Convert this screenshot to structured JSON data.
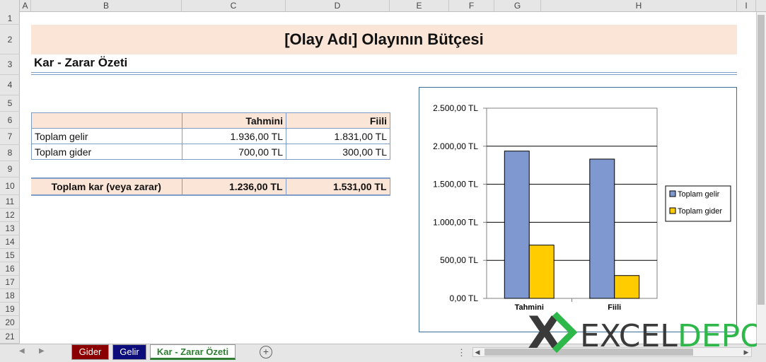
{
  "columns": [
    "A",
    "B",
    "C",
    "D",
    "E",
    "F",
    "G",
    "H",
    "I"
  ],
  "rows": [
    "1",
    "2",
    "3",
    "4",
    "5",
    "6",
    "7",
    "8",
    "9",
    "10",
    "11",
    "12",
    "13",
    "14",
    "15",
    "16",
    "17",
    "18",
    "19",
    "20",
    "21"
  ],
  "sheet": {
    "title": "[Olay Adı] Olayının Bütçesi",
    "subtitle": "Kar - Zarar Özeti",
    "table": {
      "headers": [
        "",
        "Tahmini",
        "Fiili"
      ],
      "rows": [
        {
          "label": "Toplam gelir",
          "tahmini": "1.936,00 TL",
          "fiili": "1.831,00 TL"
        },
        {
          "label": "Toplam gider",
          "tahmini": "700,00 TL",
          "fiili": "300,00 TL"
        }
      ],
      "total": {
        "label": "Toplam kar (veya zarar)",
        "tahmini": "1.236,00 TL",
        "fiili": "1.531,00 TL"
      }
    }
  },
  "chart_data": {
    "type": "bar",
    "categories": [
      "Tahmini",
      "Fiili"
    ],
    "series": [
      {
        "name": "Toplam gelir",
        "values": [
          1936,
          1831
        ],
        "color": "#7f98cf"
      },
      {
        "name": "Toplam gider",
        "values": [
          700,
          300
        ],
        "color": "#ffcc00"
      }
    ],
    "ylim": [
      0,
      2500
    ],
    "yticks": [
      "0,00 TL",
      "500,00 TL",
      "1.000,00 TL",
      "1.500,00 TL",
      "2.000,00 TL",
      "2.500,00 TL"
    ],
    "grid": true,
    "legend": "right"
  },
  "tabs": {
    "gider": "Gider",
    "gelir": "Gelir",
    "ozet": "Kar - Zarar Özeti",
    "add": "+",
    "more": "⋮"
  },
  "logo": {
    "x": "X",
    "text1": "EXCEL",
    "text2": "DEPO"
  },
  "colors": {
    "accent_green": "#2e7d32",
    "header_fill": "#fbe5d6",
    "border_blue": "#7f9cc7"
  }
}
